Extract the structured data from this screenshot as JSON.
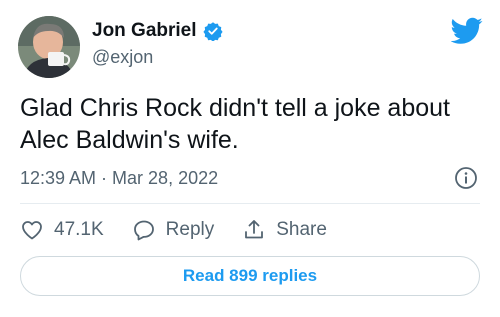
{
  "author": {
    "name": "Jon Gabriel",
    "handle": "@exjon"
  },
  "tweet": {
    "text": "Glad Chris Rock didn't tell a joke about Alec Baldwin's wife.",
    "timestamp": "12:39 AM · Mar 28, 2022"
  },
  "actions": {
    "likes": "47.1K",
    "reply_label": "Reply",
    "share_label": "Share"
  },
  "read_replies_label": "Read 899 replies",
  "colors": {
    "accent": "#1d9bf0",
    "text_secondary": "#536471"
  },
  "icons": [
    "twitter-bird-icon",
    "verified-badge-icon",
    "info-icon",
    "heart-icon",
    "reply-icon",
    "share-icon"
  ]
}
